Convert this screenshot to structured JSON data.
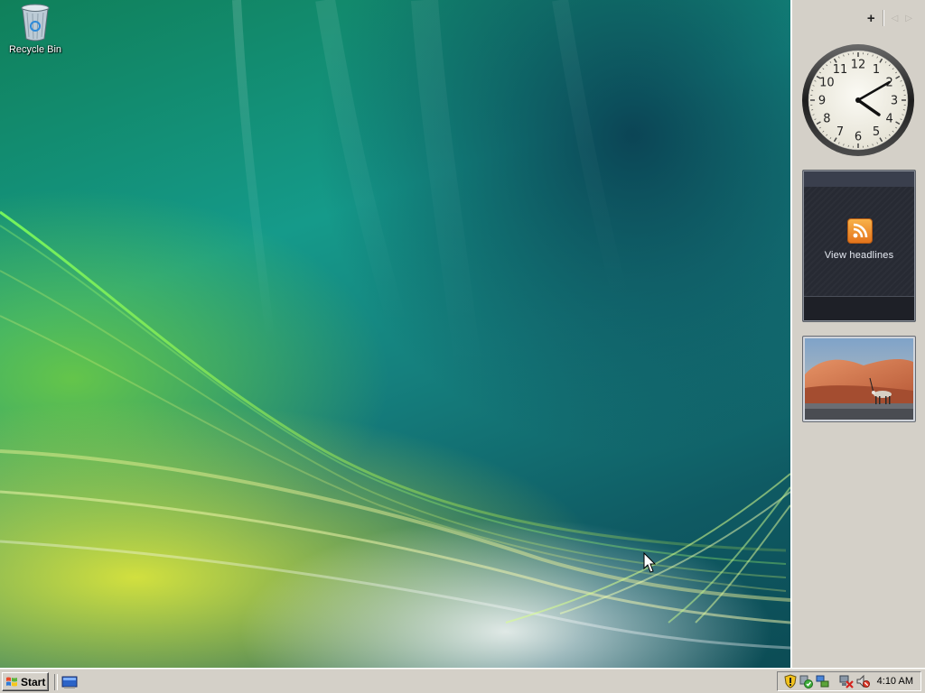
{
  "desktop": {
    "icons": [
      {
        "name": "recycle-bin",
        "label": "Recycle Bin"
      }
    ]
  },
  "sidebar": {
    "controls": {
      "add": "+",
      "prev": "◁",
      "next": "▷"
    },
    "clock": {
      "hour": 4,
      "minute": 10,
      "numerals": [
        "12",
        "1",
        "2",
        "3",
        "4",
        "5",
        "6",
        "7",
        "8",
        "9",
        "10",
        "11"
      ]
    },
    "feeds": {
      "label": "View headlines",
      "icon": "rss-icon"
    },
    "slideshow": {
      "icon": "desert-oryx-photo"
    }
  },
  "taskbar": {
    "start_label": "Start",
    "quick_launch": [
      "show-desktop-icon"
    ],
    "tray_icons": [
      "security-shield-icon",
      "security-center-icon",
      "network-icon",
      "network-disconnected-icon",
      "volume-muted-icon"
    ],
    "clock": "4:10 AM"
  },
  "colors": {
    "taskbar": "#d4d0c8",
    "sidebar": "#d4d0c8",
    "rss": "#f08a24"
  }
}
